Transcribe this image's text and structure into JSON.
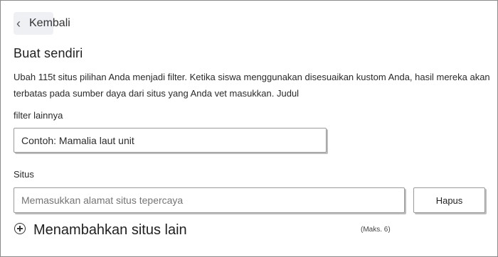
{
  "header": {
    "back_label": "Kembali"
  },
  "main": {
    "title": "Buat sendiri",
    "description": "Ubah 115t situs pilihan Anda menjadi filter. Ketika siswa menggunakan disesuaikan kustom Anda, hasil mereka akan terbatas pada sumber daya dari situs yang Anda vet masukkan. Judul",
    "filter": {
      "label": "filter lainnya",
      "value": "Contoh: Mamalia laut unit"
    },
    "site": {
      "label": "Situs",
      "placeholder": "Memasukkan alamat situs tepercaya",
      "delete_label": "Hapus"
    },
    "add_site": {
      "label": "Menambahkan situs lain",
      "max_note": "(Maks. 6)"
    }
  }
}
